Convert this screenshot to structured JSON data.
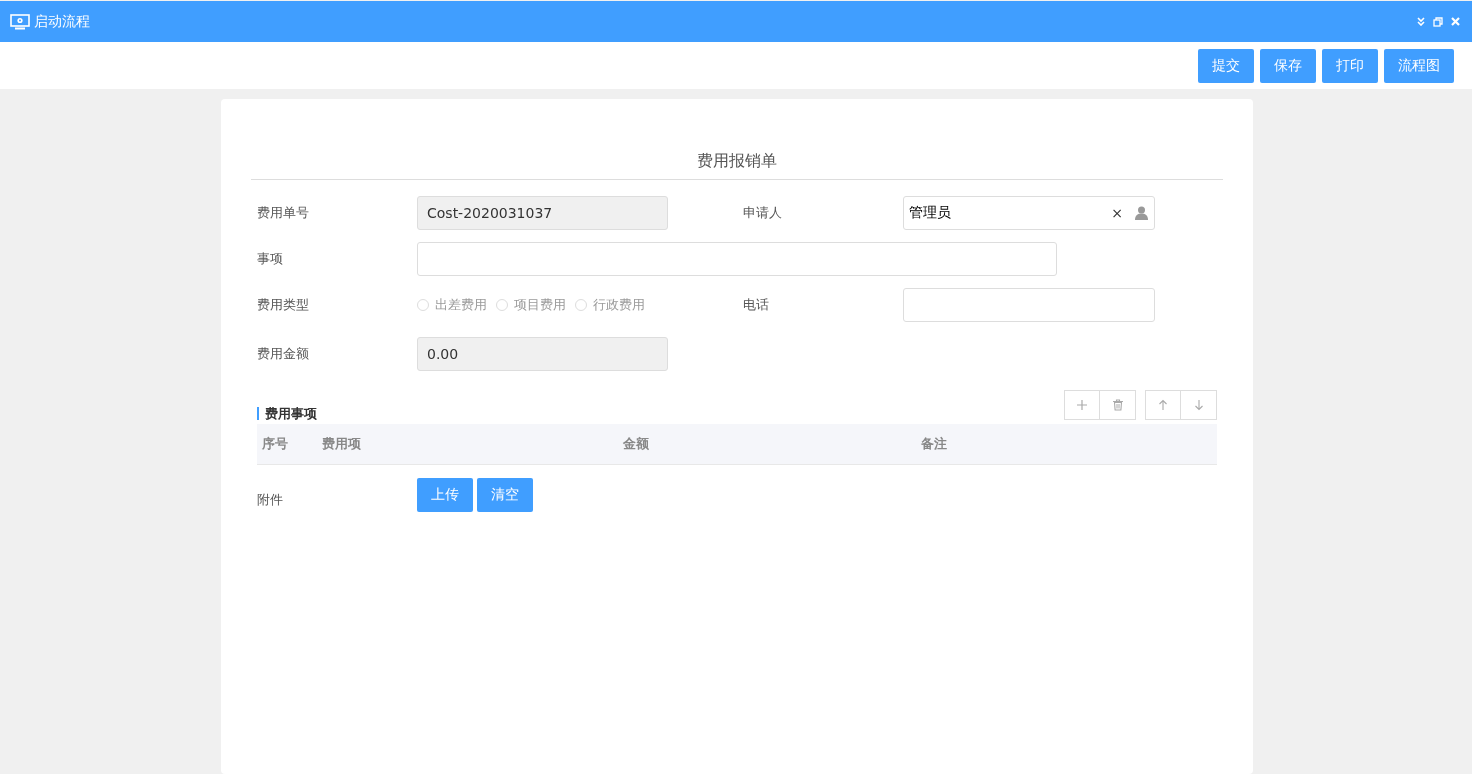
{
  "window": {
    "title": "启动流程"
  },
  "toolbar": {
    "buttons": [
      "提交",
      "保存",
      "打印",
      "流程图"
    ]
  },
  "form": {
    "title": "费用报销单",
    "rows": [
      {
        "fields": [
          {
            "kind": "text",
            "label": "费用单号",
            "value": "Cost-2020031037",
            "readonly": true
          },
          {
            "kind": "picker",
            "label": "申请人",
            "value": "管理员",
            "clear": "×"
          }
        ]
      },
      {
        "fields": [
          {
            "kind": "wide",
            "label": "事项",
            "readonly": false
          }
        ]
      },
      {
        "fields": [
          {
            "kind": "radio",
            "label": "费用类型",
            "options": [
              {
                "label": "出差费用",
                "selected": false
              },
              {
                "label": "项目费用",
                "selected": false
              },
              {
                "label": "行政费用",
                "selected": false
              }
            ]
          },
          {
            "kind": "text",
            "label": "电话",
            "readonly": false
          }
        ]
      },
      {
        "fields": [
          {
            "kind": "text",
            "label": "费用金额",
            "value": "0.00",
            "readonly": true
          }
        ]
      }
    ],
    "detail": {
      "title": "费用事项",
      "columns": [
        "序号",
        "费用项",
        "金额",
        "备注"
      ]
    },
    "attachment": {
      "label": "附件",
      "buttons": [
        "上传",
        "清空"
      ]
    }
  }
}
